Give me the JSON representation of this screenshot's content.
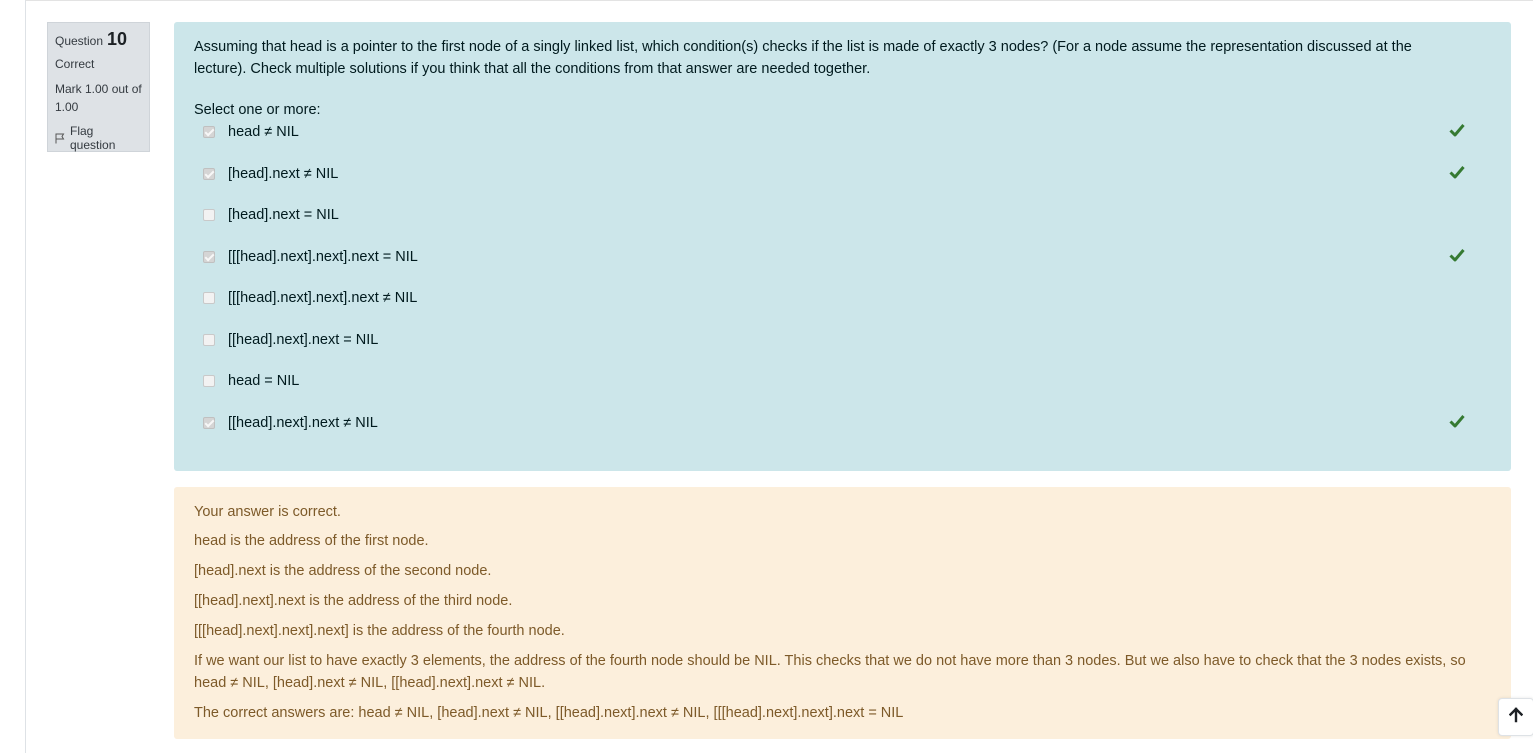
{
  "question_info": {
    "label": "Question",
    "number": "10",
    "state": "Correct",
    "grade": "Mark 1.00 out of 1.00",
    "flag_label": "Flag question"
  },
  "question": {
    "text": "Assuming that head is a pointer to the first node of a singly linked list, which condition(s) checks if the list is made of exactly 3 nodes? (For a node assume the representation discussed at the lecture). Check multiple solutions if you think that all the conditions from that answer are needed together.",
    "prompt": "Select one or more:",
    "answers": [
      {
        "label": "head ≠ NIL",
        "checked": true,
        "correct_mark": true
      },
      {
        "label": "[head].next  ≠ NIL",
        "checked": true,
        "correct_mark": true
      },
      {
        "label": "[head].next = NIL",
        "checked": false,
        "correct_mark": false
      },
      {
        "label": "[[[head].next].next].next = NIL",
        "checked": true,
        "correct_mark": true
      },
      {
        "label": "[[[head].next].next].next ≠ NIL",
        "checked": false,
        "correct_mark": false
      },
      {
        "label": "[[head].next].next = NIL",
        "checked": false,
        "correct_mark": false
      },
      {
        "label": "head = NIL",
        "checked": false,
        "correct_mark": false
      },
      {
        "label": "[[head].next].next ≠ NIL",
        "checked": true,
        "correct_mark": true
      }
    ]
  },
  "feedback": {
    "result": "Your answer is correct.",
    "lines": [
      "head is the address of the first node.",
      "[head].next is the address of the second node.",
      "[[head].next].next is the address of the third node.",
      "[[[head].next].next].next] is the address of the fourth node.",
      "If we want our list to have exactly 3 elements, the address of the fourth node should be NIL. This checks that we do not have more than 3 nodes. But we also have to check that the 3 nodes exists, so head ≠ NIL, [head].next ≠ NIL, [[head].next].next ≠ NIL."
    ],
    "right_answer": "The correct answers are: head ≠ NIL, [head].next  ≠ NIL, [[head].next].next ≠ NIL, [[[head].next].next].next = NIL"
  },
  "colors": {
    "formulation_bg": "#cce6ea",
    "feedback_bg": "#fcefdc",
    "correct_tick": "#357a32",
    "info_bg": "#dee2e6"
  },
  "icons": {
    "flag": "flag-outline-icon",
    "tick": "check-icon",
    "scroll_top": "arrow-up-icon"
  }
}
